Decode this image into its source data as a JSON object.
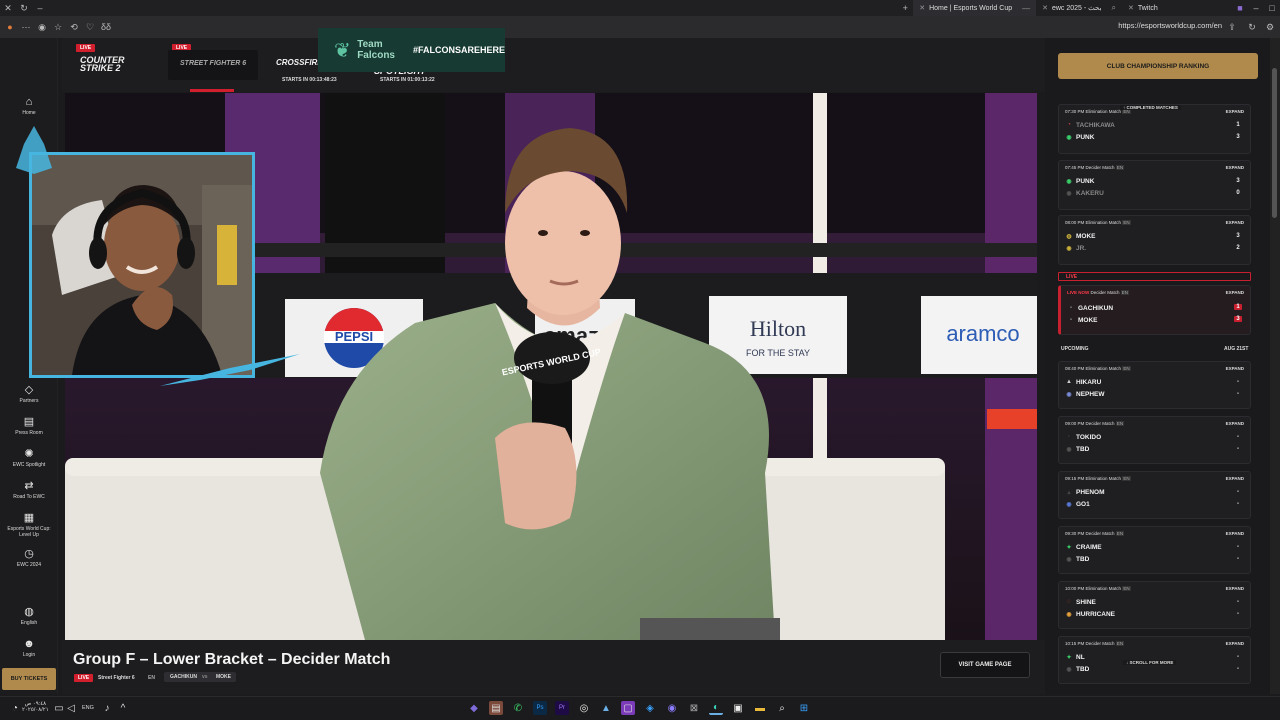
{
  "browser": {
    "tabs": [
      {
        "label": "Home | Esports World Cup",
        "active": true
      },
      {
        "label": "ewc 2025 - بحث",
        "active": false
      },
      {
        "label": "Twitch",
        "active": false
      }
    ],
    "url": "https://esportsworldcup.com/en",
    "address_left_text": "δδ"
  },
  "sidebar": {
    "items": [
      {
        "icon": "home-icon",
        "glyph": "⌂",
        "label": "Home"
      },
      {
        "icon": "partners-icon",
        "glyph": "◇",
        "label": "Partners"
      },
      {
        "icon": "press-room-icon",
        "glyph": "▤",
        "label": "Press Room"
      },
      {
        "icon": "spotlight-icon",
        "glyph": "✺",
        "label": "EWC Spotlight"
      },
      {
        "icon": "road-icon",
        "glyph": "⇄",
        "label": "Road To EWC"
      },
      {
        "icon": "calendar-icon",
        "glyph": "▦",
        "label": "Esports World Cup: Level Up"
      },
      {
        "icon": "history-icon",
        "glyph": "◷",
        "label": "EWC 2024"
      },
      {
        "icon": "globe-icon",
        "glyph": "◍",
        "label": "English"
      },
      {
        "icon": "user-icon",
        "glyph": "☻",
        "label": "Login"
      }
    ],
    "buy_tickets": "BUY TICKETS"
  },
  "gamestrip": {
    "live_label": "LIVE",
    "games": [
      {
        "name": "COUNTER STRIKE 2",
        "live": true
      },
      {
        "name": "STREET FIGHTER 6",
        "live": true
      },
      {
        "name": "CROSSFIRE",
        "starts": "STARTS IN 00:13:48:23"
      },
      {
        "name": "SPOTLIGHT",
        "starts": "STARTS IN 01:00:13:22"
      }
    ],
    "banner": {
      "team": "Team Falcons",
      "hashtag": "#FALCONSAREHERE"
    }
  },
  "video": {
    "sponsors": [
      "PEPSI",
      "amazon",
      "Hilton",
      "FOR THE STAY",
      "aramco"
    ],
    "mic_text": "ESPORTS WORLD CUP"
  },
  "match": {
    "title": "Group F – Lower Bracket – Decider Match",
    "status": "LIVE",
    "game": "Street Fighter 6",
    "lang": "EN",
    "team_a": "GACHIKUN",
    "vs": "vs",
    "team_b": "MOKE",
    "visit_button": "VISIT GAME PAGE"
  },
  "rightpanel": {
    "ranking_button": "CLUB CHAMPIONSHIP RANKING",
    "completed_label": "COMPLETED MATCHES",
    "live_section": "LIVE",
    "upcoming_section": "UPCOMING",
    "upcoming_date": "AUG 21ST",
    "scroll_more": "SCROLL FOR MORE",
    "expand": "EXPAND",
    "cards": [
      {
        "time": "07:30 PM",
        "type": "Elimination Match",
        "lang": "EN",
        "team_a": "TACHIKAWA",
        "score_a": "1",
        "team_b": "PUNK",
        "score_b": "3",
        "a_dim": true,
        "b_dim": false
      },
      {
        "time": "07:45 PM",
        "type": "Decider Match",
        "lang": "EN",
        "team_a": "PUNK",
        "score_a": "3",
        "team_b": "KAKERU",
        "score_b": "0",
        "a_dim": false,
        "b_dim": true
      },
      {
        "time": "08:00 PM",
        "type": "Elimination Match",
        "lang": "EN",
        "team_a": "MOKE",
        "score_a": "3",
        "team_b": "JR.",
        "score_b": "2",
        "a_dim": false,
        "b_dim": true
      },
      {
        "time": "LIVE NOW",
        "type": "Decider Match",
        "lang": "EN",
        "team_a": "GACHIKUN",
        "score_a": "1",
        "team_b": "MOKE",
        "score_b": "3",
        "live": true
      },
      {
        "time": "08:40 PM",
        "type": "Elimination Match",
        "lang": "EN",
        "team_a": "HIKARU",
        "score_a": "-",
        "team_b": "NEPHEW",
        "score_b": "-"
      },
      {
        "time": "09:00 PM",
        "type": "Decider Match",
        "lang": "EN",
        "team_a": "TOKIDO",
        "score_a": "-",
        "team_b": "TBD",
        "score_b": "-"
      },
      {
        "time": "09:15 PM",
        "type": "Elimination Match",
        "lang": "EN",
        "team_a": "PHENOM",
        "score_a": "-",
        "team_b": "GO1",
        "score_b": "-"
      },
      {
        "time": "09:30 PM",
        "type": "Decider Match",
        "lang": "EN",
        "team_a": "CRAIME",
        "score_a": "-",
        "team_b": "TBD",
        "score_b": "-"
      },
      {
        "time": "10:00 PM",
        "type": "Elimination Match",
        "lang": "EN",
        "team_a": "SHINE",
        "score_a": "-",
        "team_b": "HURRICANE",
        "score_b": "-"
      },
      {
        "time": "10:15 PM",
        "type": "Decider Match",
        "lang": "EN",
        "team_a": "NL",
        "score_a": "-",
        "team_b": "TBD",
        "score_b": "-"
      }
    ]
  },
  "taskbar": {
    "time": "٠٩:٤٨ ص",
    "date": "٢٠٢٥/٠٨/٢١",
    "lang": "ENG"
  },
  "colors": {
    "gold": "#b08a4c",
    "live_red": "#d21f2d",
    "falcons_green": "#173b33"
  }
}
